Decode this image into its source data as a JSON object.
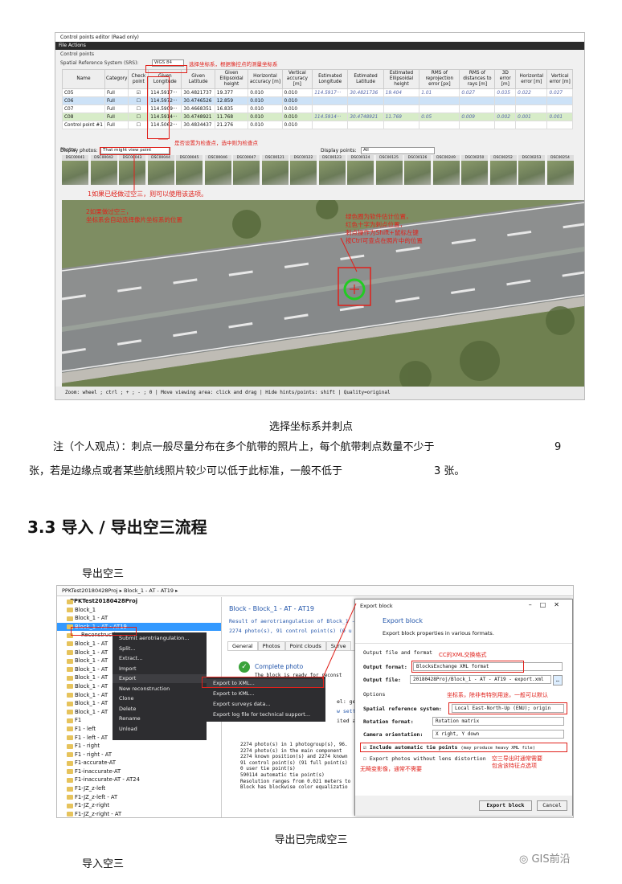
{
  "fig1": {
    "window_title": "Control points editor (Read only)",
    "menu": "File  Actions",
    "section_cp": "Control points",
    "srs_label": "Spatial Reference System (SRS):",
    "srs_value": "WGS 84",
    "note_srs": "选择坐标系，根据像控点的测量坐标系",
    "columns": [
      "Name",
      "Category",
      "Check point",
      "Given Longitude",
      "Given Latitude",
      "Given Ellipsoidal height",
      "Horizontal accuracy [m]",
      "Vertical accuracy [m]",
      "Estimated Longitude",
      "Estimated Latitude",
      "Estimated Ellipsoidal height",
      "RMS of reprojection error [px]",
      "RMS of distances to rays [m]",
      "3D error [m]",
      "Horizontal error [m]",
      "Vertical error [m]"
    ],
    "rows": [
      [
        "C05",
        "Full",
        "☑",
        "114.5917···",
        "30.4821737",
        "19.377",
        "0.010",
        "0.010",
        "114.5917···",
        "30.4821736",
        "19.404",
        "1.01",
        "0.027",
        "0.035",
        "0.022",
        "0.027"
      ],
      [
        "C06",
        "Full",
        "☐",
        "114.5972···",
        "30.4746526",
        "12.859",
        "0.010",
        "0.010",
        "",
        "",
        "",
        "",
        "",
        "",
        "",
        ""
      ],
      [
        "C07",
        "Full",
        "☐",
        "114.5909···",
        "30.4668351",
        "16.835",
        "0.010",
        "0.010",
        "",
        "",
        "",
        "",
        "",
        "",
        "",
        ""
      ],
      [
        "C08",
        "Full",
        "☐",
        "114.5914···",
        "30.4748921",
        "11.768",
        "0.010",
        "0.010",
        "114.5914···",
        "30.4748921",
        "11.769",
        "0.05",
        "0.009",
        "0.002",
        "0.001",
        "0.001"
      ],
      [
        "Control point #1",
        "Full",
        "☐",
        "114.5062···",
        "30.4834437",
        "21.276",
        "0.010",
        "0.010",
        "",
        "",
        "",
        "",
        "",
        "",
        "",
        ""
      ]
    ],
    "note_check": "是否设置为检查点，选中则为检查点",
    "section_photos": "Photos",
    "display_photos_label": "Display photos:",
    "display_photos_value": "That might view point",
    "display_points_label": "Display points:",
    "display_points_value": "All",
    "thumb_labels": [
      "DSC00041",
      "DSC00042",
      "DSC00043",
      "DSC00044",
      "DSC00045",
      "DSC00046",
      "DSC00047",
      "DSC00121",
      "DSC00122",
      "DSC00123",
      "DSC00124",
      "DSC00125",
      "DSC00126",
      "DSC00249",
      "DSC00250",
      "DSC00252",
      "DSC00253",
      "DSC00254"
    ],
    "note_aerotri": "1如果已经做过空三，则可以使用该选项。",
    "note_overlay1": "2如果做过空三，",
    "note_overlay2": "坐标系会自动选择像片坐标系的位置",
    "note_green1": "绿色圈为软件估计位置，",
    "note_green2": "红色十字为刺点位置，",
    "note_green3": "刺点操作为Shift+鼠标左键",
    "note_green4": "按Ctrl可查点在照片中的位置",
    "status": "Zoom: wheel ; ctrl ; + ; - ; 0 | Move viewing area: click and drag | Hide hints/points: shift | Quality=original"
  },
  "caption1": "选择坐标系并刺点",
  "note_para_1": "注（个人观点）：刺点一般尽量分布在多个航带的照片上，每个航带刺点数量不少于",
  "note_para_num": "9",
  "note_para_2": "张，若是边缘点或者某些航线照片较少可以低于此标准，一般不低于",
  "note_para_num2": "3 张。",
  "heading": "3.3 导入 / 导出空三流程",
  "sub_export": "导出空三",
  "fig2": {
    "breadcrumb": "PPKTest20180428Proj ▸ Block_1 - AT - AT19 ▸",
    "tree": [
      "PPKTest20180428Proj",
      "Block_1",
      "Block_1 - AT",
      "Block_1 - AT - AT19",
      "Reconstruction",
      "Block_1 - AT",
      "Block_1 - AT",
      "Block_1 - AT",
      "Block_1 - AT",
      "Block_1 - AT",
      "Block_1 - AT",
      "Block_1 - AT",
      "Block_1 - AT",
      "Block_1 - AT",
      "F1",
      "F1 - left",
      "F1 - left - AT",
      "F1 - right",
      "F1 - right - AT",
      "F1-accurate-AT",
      "F1-inaccurate-AT",
      "F1-inaccurate-AT - AT24",
      "F1-JZ_z-left",
      "F1-JZ_z-left - AT",
      "F1-JZ_z-right",
      "F1-JZ_z-right - AT"
    ],
    "menu": [
      "Submit aerotriangulation...",
      "Split...",
      "Extract...",
      "Import",
      "Export",
      "New reconstruction",
      "Clone",
      "Delete",
      "Rename",
      "Unload"
    ],
    "submenu": [
      "Export to XML...",
      "Export to KML...",
      "Export surveys data...",
      "Export log file for technical support..."
    ],
    "panel_title": "Block - Block_1 - AT - AT19",
    "panel_result": "Result of aerotriangulation of Block_1 -",
    "panel_stats": "2274 photo(s), 91 control point(s) (0 u",
    "tabs": [
      "General",
      "Photos",
      "Point clouds",
      "Surve"
    ],
    "complete": "Complete photo",
    "complete_sub": "The block is ready for reconst",
    "details": [
      "2274 photo(s) in 1 photogroup(s), 96.",
      "2274 photo(s) in the main component",
      "2274 known position(s) and 2274 known",
      "91 control point(s) (91 full point(s)",
      "0 user tie point(s)",
      "590114 automatic tie point(s)",
      "Resolution ranges from 0.021 meters to",
      "Block has blockwise color equalizatio"
    ],
    "side_frag": [
      "el: geor",
      "w settin",
      "ited aft"
    ],
    "dialog_title": "Export block",
    "dialog_heading": "Export block",
    "dialog_desc": "Export block properties in various formats.",
    "sec_output": "Output file and format",
    "label_format": "Output format:",
    "value_format": "BlocksExchange XML format",
    "label_file": "Output file:",
    "value_file": "20180428Proj/Block_1 - AT - AT19 - export.xml",
    "sec_options": "Options",
    "label_srs": "Spatial reference system:",
    "value_srs": "Local East-North-Up (ENU); origin",
    "label_rot": "Rotation format:",
    "value_rot": "Rotation matrix",
    "label_cam": "Camera orientation:",
    "value_cam": "X right, Y down",
    "chk_tie": "Include automatic tie points",
    "chk_tie_note": "(may produce heavy XML file)",
    "chk_lens": "Export photos without lens distortion",
    "btn_export": "Export block",
    "btn_cancel": "Cancel",
    "note_cc": "CC的XML交换格式",
    "note_srs": "坐标系，除非有特别用途，一般可以默认",
    "note_tie1": "空三导出时通常需要",
    "note_tie2": "包含该特征点选项",
    "note_lens1": "无畸变影像，通常不需要"
  },
  "caption2": "导出已完成空三",
  "watermark": "GIS前沿",
  "sub_import": "导入空三",
  "colors": {
    "red": "#e0211b",
    "green_circle": "#22cc22",
    "blue_select": "#3399ff",
    "ctx_bg": "#2d2d30"
  },
  "icons": [
    "checkmark-icon",
    "folder-icon",
    "chevron-right-icon",
    "wechat-icon",
    "close-icon",
    "minimize-icon",
    "maximize-icon"
  ]
}
